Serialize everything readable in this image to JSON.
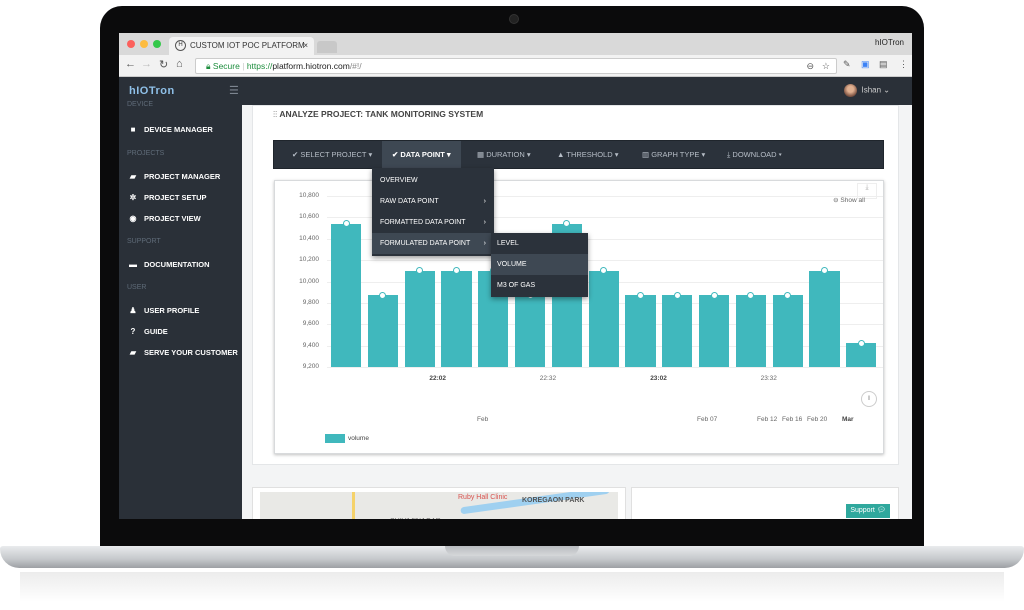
{
  "browser": {
    "tab_title": "CUSTOM IOT POC PLATFORM",
    "tab_favicon": "H",
    "window_title": "hIOTron",
    "secure_label": "Secure",
    "url_scheme": "https://",
    "url_host": "platform.hiotron.com",
    "url_path": "/#!/"
  },
  "app": {
    "logo": "hIOTron",
    "user_name": "Ishan"
  },
  "sidebar": {
    "sections": [
      {
        "label": "DEVICE"
      },
      {
        "label": "PROJECTS"
      },
      {
        "label": "SUPPORT"
      },
      {
        "label": "USER"
      }
    ],
    "items": [
      {
        "label": "DEVICE MANAGER",
        "icon": "chip-icon"
      },
      {
        "label": "PROJECT MANAGER",
        "icon": "folder-open-icon"
      },
      {
        "label": "PROJECT SETUP",
        "icon": "gear-icon"
      },
      {
        "label": "PROJECT VIEW",
        "icon": "eye-icon"
      },
      {
        "label": "DOCUMENTATION",
        "icon": "book-icon"
      },
      {
        "label": "USER PROFILE",
        "icon": "user-icon"
      },
      {
        "label": "GUIDE",
        "icon": "question-icon"
      },
      {
        "label": "SERVE YOUR CUSTOMER",
        "icon": "folder-open-icon"
      }
    ]
  },
  "page": {
    "title": "ANALYZE PROJECT: TANK MONITORING SYSTEM"
  },
  "toolbar": {
    "items": [
      {
        "label": "SELECT PROJECT",
        "icon": "check-circle-icon"
      },
      {
        "label": "DATA POINT",
        "icon": "check-circle-icon",
        "active": true
      },
      {
        "label": "DURATION",
        "icon": "calendar-icon"
      },
      {
        "label": "THRESHOLD",
        "icon": "warning-icon"
      },
      {
        "label": "GRAPH TYPE",
        "icon": "bar-chart-icon"
      },
      {
        "label": "DOWNLOAD",
        "icon": "download-icon"
      }
    ]
  },
  "data_point_menu": {
    "items": [
      {
        "label": "OVERVIEW",
        "has_submenu": false
      },
      {
        "label": "RAW DATA POINT",
        "has_submenu": true
      },
      {
        "label": "FORMATTED DATA POINT",
        "has_submenu": true
      },
      {
        "label": "FORMULATED DATA POINT",
        "has_submenu": true,
        "highlighted": true
      }
    ],
    "submenu": [
      {
        "label": "LEVEL"
      },
      {
        "label": "VOLUME",
        "highlighted": true
      },
      {
        "label": "M3 OF GAS"
      }
    ]
  },
  "chart_controls": {
    "show_all_label": "Show all"
  },
  "chart_data": {
    "type": "bar",
    "title": "",
    "xlabel": "",
    "ylabel": "",
    "ylim": [
      9200,
      10800
    ],
    "yticks": [
      "10,800",
      "10,600",
      "10,400",
      "10,200",
      "10,000",
      "9,800",
      "9,600",
      "9,400",
      "9,200"
    ],
    "series": [
      {
        "name": "volume",
        "color": "#40b8bd",
        "values": [
          10540,
          9870,
          10100,
          10100,
          10100,
          9870,
          10540,
          10100,
          9870,
          9870,
          9870,
          9870,
          9870,
          10100,
          9420
        ]
      }
    ],
    "xticks": [
      {
        "label": "22:02",
        "after_bar": 3,
        "bold": true
      },
      {
        "label": "22:32",
        "after_bar": 6,
        "bold": false
      },
      {
        "label": "23:02",
        "after_bar": 9,
        "bold": true
      },
      {
        "label": "23:32",
        "after_bar": 12,
        "bold": false
      }
    ],
    "navigator_labels": [
      "Feb",
      "Feb 07",
      "Feb 12",
      "Feb 16",
      "Feb 20",
      "Mar"
    ],
    "legend": "bottom-left",
    "grid": true
  },
  "map": {
    "labels": [
      "KOREGAON PARK",
      "Ruby Hall Clinic",
      "SHIVAJINAGAR"
    ]
  },
  "support_button": {
    "label": "Support"
  }
}
